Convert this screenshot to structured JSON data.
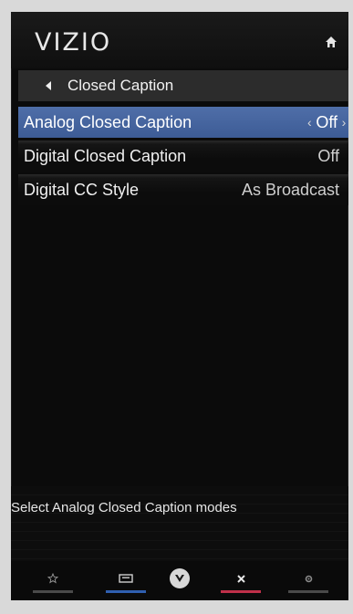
{
  "header": {
    "brand": "VIZIO",
    "home_icon": "home-icon"
  },
  "breadcrumb": {
    "label": "Closed Caption",
    "back_icon": "back-arrow-icon"
  },
  "menu": {
    "items": [
      {
        "label": "Analog Closed Caption",
        "value": "Off",
        "selected": true
      },
      {
        "label": "Digital Closed Caption",
        "value": "Off",
        "selected": false
      },
      {
        "label": "Digital CC Style",
        "value": "As Broadcast",
        "selected": false
      }
    ]
  },
  "help": {
    "text": "Select Analog Closed Caption modes"
  },
  "footer": {
    "buttons": [
      {
        "icon": "star-icon",
        "underline": "#555555"
      },
      {
        "icon": "input-icon",
        "underline": "#2f5fb0"
      },
      {
        "icon": "vizio-v-icon",
        "underline": ""
      },
      {
        "icon": "close-icon",
        "underline": "#c0304a"
      },
      {
        "icon": "gear-icon",
        "underline": "#555555"
      }
    ]
  },
  "colors": {
    "selected_bg": "#4a69a3",
    "panel_bg": "#0b0b0b",
    "text": "#f0f0f0"
  }
}
